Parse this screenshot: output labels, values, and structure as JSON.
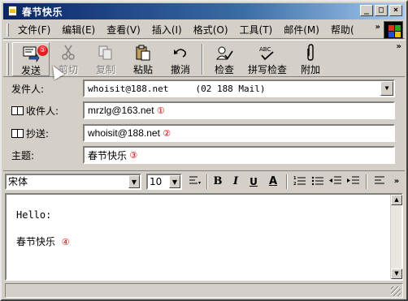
{
  "window": {
    "title": "春节快乐"
  },
  "title_controls": {
    "minimize": "_",
    "maximize": "□",
    "close": "×"
  },
  "menu": [
    {
      "label": "文件(F)"
    },
    {
      "label": "编辑(E)"
    },
    {
      "label": "查看(V)"
    },
    {
      "label": "插入(I)"
    },
    {
      "label": "格式(O)"
    },
    {
      "label": "工具(T)"
    },
    {
      "label": "邮件(M)"
    },
    {
      "label": "帮助("
    }
  ],
  "menu_overflow": "»",
  "toolbar": {
    "send": "发送",
    "send_marker": "⑤",
    "cut": "剪切",
    "copy": "复制",
    "paste": "粘贴",
    "undo": "撤消",
    "check": "检查",
    "spell": "拼写检查",
    "attach": "附加",
    "overflow": "»"
  },
  "header": {
    "from_label": "发件人:",
    "from_value": "whoisit@188.net     (02 188 Mail)",
    "to_label": "收件人:",
    "to_value": "mrzlg@163.net",
    "to_marker": "①",
    "cc_label": "抄送:",
    "cc_value": "whoisit@188.net",
    "cc_marker": "②",
    "subject_label": "主题:",
    "subject_value": "春节快乐",
    "subject_marker": "③"
  },
  "format": {
    "font": "宋体",
    "size": "10",
    "bold": "B",
    "italic": "I",
    "underline": "U",
    "color": "A",
    "overflow": "»"
  },
  "body": {
    "line1": "Hello:",
    "line2": "春节快乐",
    "line2_marker": "④"
  },
  "colors": {
    "title_bar": "#0a246a",
    "face": "#d4d0c8",
    "marker": "#d00000"
  }
}
